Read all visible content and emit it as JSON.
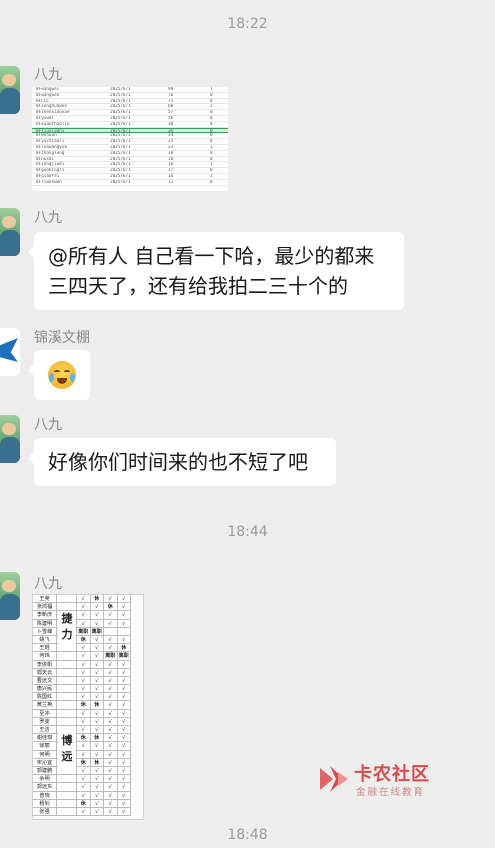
{
  "timestamps": [
    "18:22",
    "18:44",
    "18:48"
  ],
  "messages": [
    {
      "sender": "八九",
      "avatar": "person-avatar",
      "type": "image"
    },
    {
      "sender": "八九",
      "avatar": "person-avatar",
      "type": "text",
      "lines": [
        "@所有人  自己看一下哈，最少的都来",
        "三四天了，还有给我拍二三十个的"
      ]
    },
    {
      "sender": "锦溪文棚",
      "avatar": "shark-avatar",
      "type": "emoji",
      "emoji": "crying-laughing-emoji"
    },
    {
      "sender": "八九",
      "avatar": "person-avatar",
      "type": "text",
      "lines": [
        "好像你们时间来的也不短了吧"
      ]
    },
    {
      "sender": "八九",
      "avatar": "person-avatar",
      "type": "image"
    }
  ],
  "sheet": {
    "rows": [
      [
        "0Fwangwei",
        "2025/6/1",
        "99",
        "1"
      ],
      [
        "0Fwangwen",
        "2025/6/1",
        "76",
        "0"
      ],
      [
        "0FCCC",
        "2025/6/1",
        "75",
        "0"
      ],
      [
        "0Fzenghuawen",
        "2025/6/1",
        "60",
        "2"
      ],
      [
        "0Fzhenxiaoxue",
        "2025/6/1",
        "57",
        "0"
      ],
      [
        "0Fyuwei",
        "2025/6/1",
        "56",
        "0"
      ],
      [
        "0Fxuanthaolin",
        "2025/6/1",
        "38",
        "0"
      ],
      [
        "0Fliuxiaoni",
        "2025/6/1",
        "36",
        "0"
      ],
      [
        "0Fwehaan",
        "2025/6/1",
        "34",
        "0"
      ],
      [
        "0Fyuxtiaoli",
        "2025/6/1",
        "25",
        "0"
      ],
      [
        "0Fluowangyue",
        "2025/6/1",
        "23",
        "1"
      ],
      [
        "0Fzhangleng",
        "2025/6/1",
        "18",
        "0"
      ],
      [
        "0Fnuxai",
        "2025/6/1",
        "18",
        "0"
      ],
      [
        "0Fzongjiwei",
        "2025/6/1",
        "16",
        "1"
      ],
      [
        "0Fguobingli",
        "2025/6/1",
        "17",
        "0"
      ],
      [
        "0Fqiaofei",
        "2025/6/1",
        "16",
        "2"
      ],
      [
        "0Fliwenwen",
        "2025/6/1",
        "11",
        "0"
      ]
    ],
    "highlight_row": 7
  },
  "schedule": {
    "group_a": "捷力",
    "group_b": "博远",
    "rows": [
      {
        "name": "王英",
        "vals": [
          "√",
          "休",
          "√",
          "√"
        ]
      },
      {
        "name": "张鸿福",
        "vals": [
          "√",
          "√",
          "休",
          "√"
        ]
      },
      {
        "name": "李新庆",
        "vals": [
          "√",
          "√",
          "√",
          "√"
        ]
      },
      {
        "name": "陈建明",
        "vals": [
          "√",
          "√",
          "√",
          "√"
        ]
      },
      {
        "name": "卜雪峰",
        "vals": [
          "离职",
          "离职",
          "",
          ""
        ]
      },
      {
        "name": "姚飞",
        "vals": [
          "休",
          "√",
          "√",
          "√"
        ]
      },
      {
        "name": "王琨",
        "vals": [
          "√",
          "√",
          "√",
          "休"
        ]
      },
      {
        "name": "何玮",
        "vals": [
          "√",
          "√",
          "离职",
          "离职"
        ]
      },
      {
        "name": "李依帆",
        "vals": [
          "√",
          "√",
          "√",
          "√"
        ]
      },
      {
        "name": "郭天云",
        "vals": [
          "√",
          "√",
          "√",
          "√"
        ]
      },
      {
        "name": "曹远文",
        "vals": [
          "√",
          "√",
          "√",
          "√"
        ]
      },
      {
        "name": "唐兴民",
        "vals": [
          "√",
          "√",
          "√",
          "√"
        ]
      },
      {
        "name": "陈国红",
        "vals": [
          "√",
          "√",
          "√",
          "√"
        ]
      },
      {
        "name": "黄兰英",
        "vals": [
          "休",
          "休",
          "√",
          "√"
        ]
      },
      {
        "name": "至冲",
        "vals": [
          "√",
          "√",
          "√",
          "√"
        ]
      },
      {
        "name": "罗雯",
        "vals": [
          "√",
          "√",
          "√",
          "√"
        ]
      },
      {
        "name": "王洁",
        "vals": [
          "√",
          "√",
          "√",
          "√"
        ]
      },
      {
        "name": "谢佳琪",
        "vals": [
          "休",
          "休",
          "√",
          "√"
        ]
      },
      {
        "name": "徐丽",
        "vals": [
          "√",
          "√",
          "√",
          "√"
        ]
      },
      {
        "name": "何明",
        "vals": [
          "√",
          "√",
          "√",
          "√"
        ]
      },
      {
        "name": "宋沁宜",
        "vals": [
          "休",
          "休",
          "√",
          "√"
        ]
      },
      {
        "name": "郭建鹏",
        "vals": [
          "√",
          "√",
          "√",
          "√"
        ]
      },
      {
        "name": "余明",
        "vals": [
          "√",
          "√",
          "√",
          "√"
        ]
      },
      {
        "name": "郭远东",
        "vals": [
          "√",
          "√",
          "√",
          "√"
        ]
      },
      {
        "name": "曾晓",
        "vals": [
          "√",
          "√",
          "√",
          "√"
        ]
      },
      {
        "name": "杨钊",
        "vals": [
          "休",
          "√",
          "√",
          "√"
        ]
      },
      {
        "name": "张强",
        "vals": [
          "√",
          "√",
          "√",
          "√"
        ]
      }
    ]
  },
  "watermark": {
    "title": "卡农社区",
    "subtitle": "金融在线教育"
  },
  "colors": {
    "background": "#ededed",
    "bubble": "#ffffff",
    "timestamp": "#9c9c9c",
    "sender": "#8a8a8a",
    "watermark": "#d94a4a"
  }
}
